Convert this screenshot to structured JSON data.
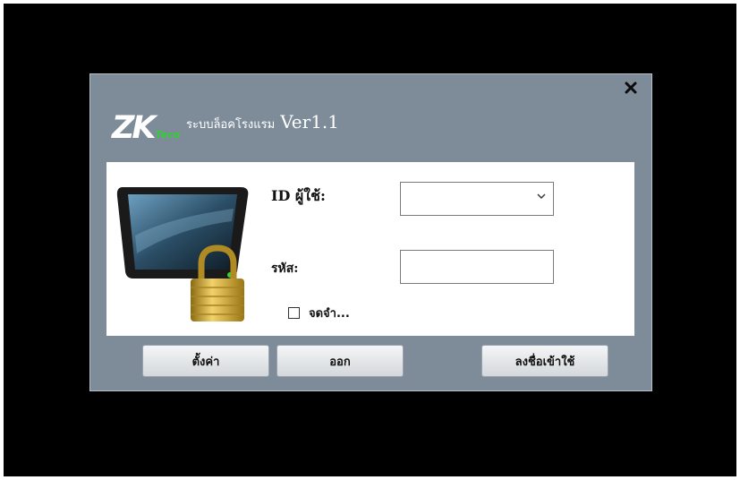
{
  "dialog": {
    "logo": {
      "main": "ZK",
      "sub": "Teco"
    },
    "title_thai": "ระบบล็อคโรงแรม",
    "title_version": "Ver1.1",
    "close_label": "×"
  },
  "form": {
    "userid_label": "ID ผู้ใช้:",
    "userid_value": "",
    "password_label": "รหัส:",
    "password_value": "",
    "remember_label": "จดจำ..."
  },
  "buttons": {
    "settings_label": "ตั้งค่า",
    "exit_label": "ออก",
    "login_label": "ลงชื่อเข้าใช้"
  }
}
